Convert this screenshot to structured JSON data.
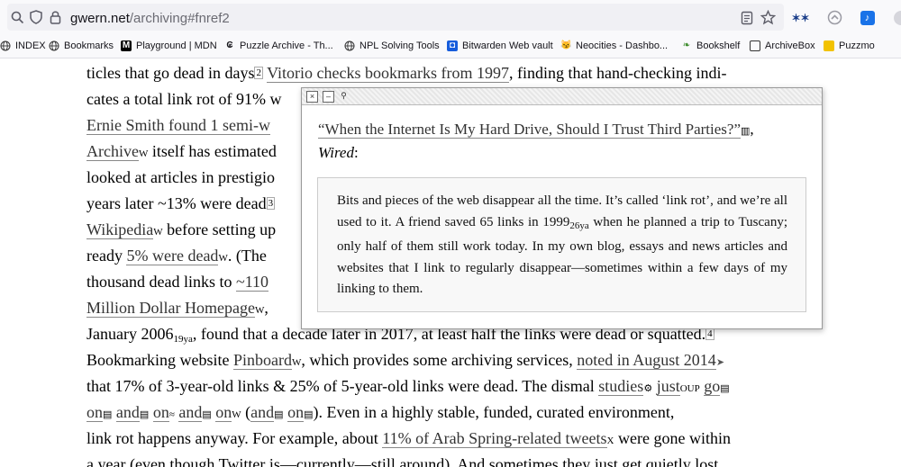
{
  "browser": {
    "url_host": "gwern.net",
    "url_path": "/archiving#fnref2"
  },
  "bookmarks": [
    {
      "label": "INDEX",
      "icon": "globe-icon"
    },
    {
      "label": "Bookmarks",
      "icon": "globe-icon"
    },
    {
      "label": "Playground | MDN",
      "icon": "mdn-icon"
    },
    {
      "label": "Puzzle Archive - Th...",
      "icon": "puzzle-icon"
    },
    {
      "label": "NPL Solving Tools",
      "icon": "globe-icon"
    },
    {
      "label": "Bitwarden Web vault",
      "icon": "bitwarden-icon"
    },
    {
      "label": "Neocities - Dashbo...",
      "icon": "neocities-icon"
    },
    {
      "label": "Bookshelf",
      "icon": "leaf-icon"
    },
    {
      "label": "ArchiveBox",
      "icon": "box-icon"
    },
    {
      "label": "Puzzmo",
      "icon": "puzzmo-icon"
    }
  ],
  "article": {
    "l1a": "ticles that go dead in days",
    "l1fn": "2",
    "l1link": "Vitorio checks bookmarks from 1997",
    "l1b": ", finding that hand-checking indi-",
    "l2": "cates a total link rot of 91% w",
    "l3link": "Ernie Smith found 1 semi-w",
    "l4link": "Archive",
    "l4w": "W",
    "l4b": " itself has estimated",
    "l5": "looked at articles in prestigio",
    "l6a": "years later ~13% were dead",
    "l6fn": "3",
    "l7link": "Wikipedia",
    "l7w": "W",
    "l7b": " before setting up",
    "l8a": "ready ",
    "l8link": "5% were dead",
    "l8w": "W",
    "l8b": ". (The",
    "l9a": "thousand dead links to ",
    "l9link": "~110",
    "l10link": "Million Dollar Homepage",
    "l10w": "W",
    "l10b": ",",
    "l11a": "January 2006",
    "l11sub": "19ya",
    "l11b": ", found that a decade later in 2017, at least half the links were dead or squatted.",
    "l11fn": "4",
    "l12a": "Bookmarking website ",
    "l12link": "Pinboard",
    "l12w": "W",
    "l12b": ", which provides some archiving services, ",
    "l12link2": "noted in August 2014",
    "l13a": "that 17% of 3-year-old links & 25% of 5-year-old links were dead. The dismal ",
    "l13link": "studies",
    "l13b": " ",
    "l13link2": "just",
    "l13sup": "OUP",
    "l13link3": "go",
    "l14link1": "on",
    "l14link2": "and",
    "l14link3": "on",
    "l14link4": "and",
    "l14link5": "on",
    "l14sup": "W",
    "l14link6": "and",
    "l14link7": "on",
    "l14b": "). Even in a highly stable, funded, curated environment,",
    "l15a": "link rot happens anyway. For example, about ",
    "l15link": "11% of Arab Spring-related tweets",
    "l15sup": "X",
    "l15b": " were gone within",
    "l16": "a year (even though Twitter is—currently—still around). And sometimes they just get quietly lost"
  },
  "popup": {
    "close_label": "×",
    "minimize_label": "–",
    "pin_label": "⚲",
    "title_link": "“When the Internet Is My Hard Drive, Should I Trust Third Parties?”",
    "title_tail": ",",
    "source": "Wired",
    "source_tail": ":",
    "quote_a": "Bits and pieces of the web disappear all the time. It’s called ‘link rot’, and we’re all used to it. A friend saved 65 links in 1999",
    "quote_sub": "26ya",
    "quote_b": " when he planned a trip to Tuscany; only half of them still work today. In my own blog, essays and news articles and websites that I link to regularly disappear—sometimes within a few days of my linking to them."
  }
}
